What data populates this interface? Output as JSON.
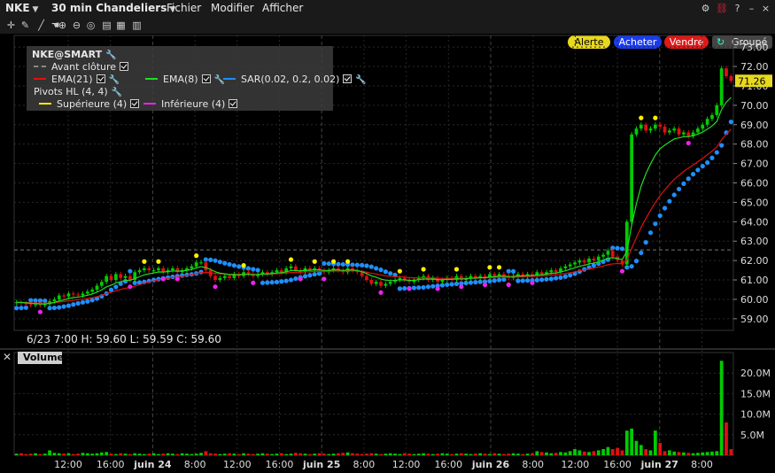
{
  "header": {
    "symbol": "NKE",
    "chart_type": "30 min Chandeliers",
    "menus": [
      "Fichier",
      "Modifier",
      "Afficher"
    ]
  },
  "buttons": {
    "alert": "Alerte",
    "buy": "Acheter",
    "sell": "Vendre",
    "group": "Groupé"
  },
  "colors": {
    "up": "#00cc00",
    "down": "#e01010",
    "ema21": "#e01010",
    "ema8": "#22dd22",
    "sar": "#1e8fff",
    "pivot_high": "#ffee00",
    "pivot_low": "#ee22ee",
    "preclose": "#777777",
    "alert_btn": "#e8d81e",
    "buy_btn": "#1a3cf0",
    "sell_btn": "#e01818"
  },
  "legend": {
    "title": "NKE@SMART",
    "preclose": "Avant clôture",
    "ema21": "EMA(21)",
    "ema8": "EMA(8)",
    "sar": "SAR(0.02, 0.2, 0.02)",
    "pivots": "Pivots HL (4, 4)",
    "upper": "Supérieure (4)",
    "lower": "Inférieure (4)"
  },
  "info_line": "6/23 7:00   H: 59.60   L: 59.59   C: 59.60",
  "volume_label": "Volume",
  "chart_data": {
    "type": "candlestick",
    "price_axis": {
      "min": 58.4,
      "max": 73.6,
      "ticks": [
        59.0,
        60.0,
        61.0,
        62.0,
        63.0,
        64.0,
        65.0,
        66.0,
        67.0,
        68.0,
        69.0,
        70.0,
        71.0,
        72.0,
        73.0
      ]
    },
    "last_price": 71.26,
    "preclose_level": 62.55,
    "volume_axis": {
      "min": 0,
      "max": 25000000,
      "ticks": [
        "5.0M",
        "10.0M",
        "15.0M",
        "20.0M"
      ],
      "tick_values": [
        5000000,
        10000000,
        15000000,
        20000000
      ]
    },
    "time_labels": [
      "12:00",
      "16:00",
      "juin 24",
      "8:00",
      "12:00",
      "16:00",
      "juin 25",
      "8:00",
      "12:00",
      "16:00",
      "juin 26",
      "8:00",
      "12:00",
      "16:00",
      "juin 27",
      "8:00"
    ],
    "close": [
      59.85,
      59.8,
      59.75,
      59.7,
      59.75,
      59.7,
      59.75,
      59.9,
      60.0,
      60.2,
      60.15,
      60.3,
      60.25,
      60.2,
      60.3,
      60.4,
      60.5,
      60.7,
      60.9,
      61.2,
      61.0,
      61.3,
      61.1,
      61.2,
      61.0,
      61.4,
      61.5,
      61.6,
      61.5,
      61.5,
      61.6,
      61.4,
      61.5,
      61.6,
      61.4,
      61.5,
      61.6,
      61.7,
      61.9,
      61.9,
      61.5,
      61.2,
      61.0,
      61.1,
      61.2,
      61.1,
      61.3,
      61.2,
      61.4,
      61.3,
      61.2,
      61.3,
      61.4,
      61.3,
      61.4,
      61.5,
      61.4,
      61.6,
      61.7,
      61.5,
      61.4,
      61.6,
      61.5,
      61.6,
      61.5,
      61.4,
      61.5,
      61.6,
      61.5,
      61.4,
      61.6,
      61.5,
      61.4,
      61.2,
      61.0,
      60.8,
      60.9,
      60.7,
      60.8,
      60.9,
      61.0,
      61.1,
      61.0,
      60.9,
      61.0,
      61.1,
      61.2,
      61.0,
      61.1,
      60.9,
      61.0,
      61.1,
      61.0,
      61.2,
      61.0,
      61.1,
      61.2,
      61.1,
      61.2,
      61.1,
      61.3,
      61.2,
      61.3,
      61.2,
      61.1,
      61.2,
      61.3,
      61.2,
      61.3,
      61.2,
      61.4,
      61.3,
      61.4,
      61.5,
      61.4,
      61.6,
      61.7,
      61.8,
      61.9,
      62.0,
      61.9,
      62.1,
      62.0,
      62.2,
      62.3,
      62.5,
      62.2,
      62.0,
      61.8,
      64.0,
      68.5,
      68.8,
      69.0,
      68.7,
      68.8,
      69.0,
      68.9,
      68.6,
      68.7,
      68.8,
      68.5,
      68.6,
      68.4,
      68.6,
      68.8,
      69.0,
      69.3,
      69.5,
      70.0,
      71.9,
      71.5,
      71.26
    ],
    "volume": [
      0.4,
      0.5,
      0.3,
      0.4,
      0.5,
      0.3,
      0.4,
      1.2,
      0.6,
      0.5,
      0.4,
      0.5,
      0.3,
      0.4,
      0.6,
      0.5,
      0.4,
      0.5,
      0.7,
      0.8,
      0.4,
      0.3,
      0.5,
      0.4,
      0.3,
      0.5,
      0.4,
      0.3,
      0.4,
      0.5,
      0.3,
      0.4,
      0.5,
      0.4,
      0.3,
      0.5,
      0.4,
      0.3,
      0.4,
      0.6,
      1.0,
      0.5,
      0.4,
      0.3,
      0.4,
      0.5,
      0.4,
      0.3,
      0.5,
      0.4,
      0.3,
      0.4,
      0.5,
      0.4,
      0.3,
      0.4,
      0.5,
      0.3,
      0.4,
      0.6,
      0.5,
      0.4,
      0.3,
      0.4,
      0.5,
      0.4,
      0.3,
      0.4,
      0.5,
      0.6,
      0.7,
      0.5,
      0.4,
      0.3,
      0.4,
      0.5,
      0.4,
      0.3,
      0.4,
      0.5,
      0.4,
      0.3,
      0.5,
      0.4,
      0.3,
      0.4,
      0.5,
      0.4,
      0.3,
      0.4,
      0.5,
      0.4,
      0.3,
      0.4,
      0.5,
      0.4,
      0.3,
      0.4,
      0.5,
      0.4,
      0.3,
      0.5,
      0.4,
      0.3,
      0.4,
      0.5,
      0.4,
      0.3,
      0.4,
      0.5,
      1.0,
      0.8,
      0.7,
      0.5,
      0.6,
      0.8,
      0.7,
      1.0,
      1.5,
      1.2,
      0.9,
      0.8,
      1.0,
      1.2,
      1.5,
      2.0,
      1.5,
      1.8,
      1.2,
      6.0,
      6.5,
      3.5,
      2.5,
      1.5,
      1.2,
      6.0,
      3.0,
      1.0,
      1.2,
      0.9,
      0.8,
      0.7,
      0.6,
      0.5,
      0.6,
      0.7,
      0.8,
      0.9,
      1.0,
      23.0,
      8.0,
      1.5
    ]
  }
}
